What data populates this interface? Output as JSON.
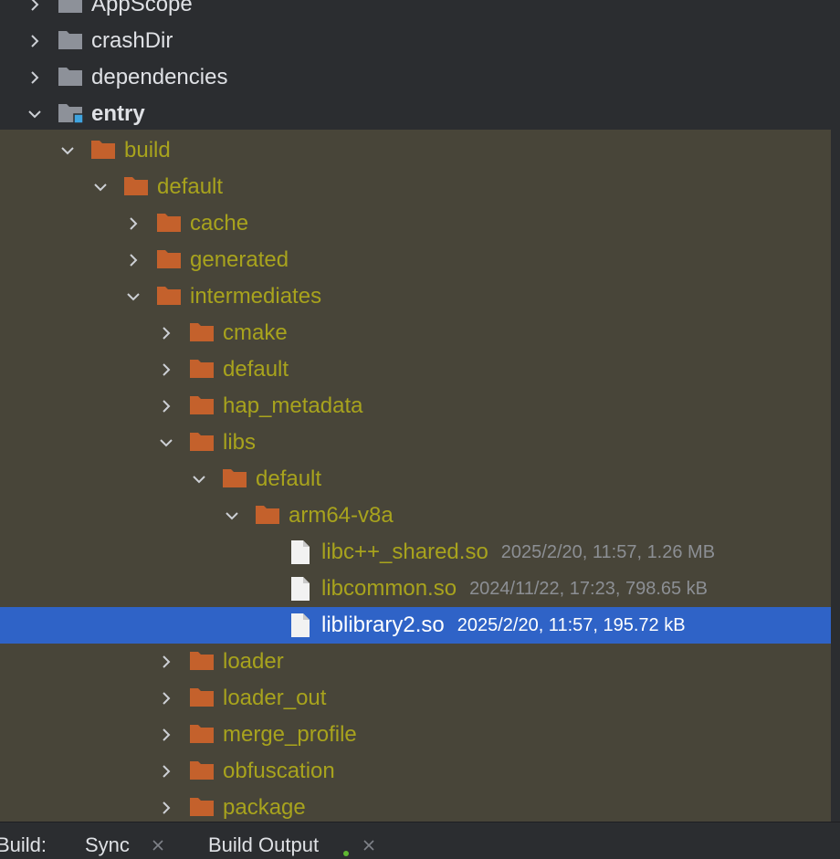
{
  "tree": {
    "rows": [
      {
        "label": "AppScope",
        "depth": 0,
        "chevron": "right",
        "icon": "folder-gray",
        "style": "normal",
        "meta": ""
      },
      {
        "label": "crashDir",
        "depth": 0,
        "chevron": "right",
        "icon": "folder-gray",
        "style": "normal",
        "meta": ""
      },
      {
        "label": "dependencies",
        "depth": 0,
        "chevron": "right",
        "icon": "folder-gray",
        "style": "normal",
        "meta": ""
      },
      {
        "label": "entry",
        "depth": 0,
        "chevron": "down",
        "icon": "folder-module",
        "style": "bold",
        "meta": ""
      },
      {
        "label": "build",
        "depth": 1,
        "chevron": "down",
        "icon": "folder-orange",
        "style": "olive",
        "meta": ""
      },
      {
        "label": "default",
        "depth": 2,
        "chevron": "down",
        "icon": "folder-orange",
        "style": "olive",
        "meta": ""
      },
      {
        "label": "cache",
        "depth": 3,
        "chevron": "right",
        "icon": "folder-orange",
        "style": "olive",
        "meta": ""
      },
      {
        "label": "generated",
        "depth": 3,
        "chevron": "right",
        "icon": "folder-orange",
        "style": "olive",
        "meta": ""
      },
      {
        "label": "intermediates",
        "depth": 3,
        "chevron": "down",
        "icon": "folder-orange",
        "style": "olive",
        "meta": ""
      },
      {
        "label": "cmake",
        "depth": 4,
        "chevron": "right",
        "icon": "folder-orange",
        "style": "olive",
        "meta": ""
      },
      {
        "label": "default",
        "depth": 4,
        "chevron": "right",
        "icon": "folder-orange",
        "style": "olive",
        "meta": ""
      },
      {
        "label": "hap_metadata",
        "depth": 4,
        "chevron": "right",
        "icon": "folder-orange",
        "style": "olive",
        "meta": ""
      },
      {
        "label": "libs",
        "depth": 4,
        "chevron": "down",
        "icon": "folder-orange",
        "style": "olive",
        "meta": ""
      },
      {
        "label": "default",
        "depth": 5,
        "chevron": "down",
        "icon": "folder-orange",
        "style": "olive",
        "meta": ""
      },
      {
        "label": "arm64-v8a",
        "depth": 6,
        "chevron": "down",
        "icon": "folder-orange",
        "style": "olive",
        "meta": ""
      },
      {
        "label": "libc++_shared.so",
        "depth": 7,
        "chevron": "none",
        "icon": "file-icon",
        "style": "olive",
        "meta": "2025/2/20, 11:57, 1.26 MB"
      },
      {
        "label": "libcommon.so",
        "depth": 7,
        "chevron": "none",
        "icon": "file-icon",
        "style": "olive",
        "meta": "2024/11/22, 17:23, 798.65 kB"
      },
      {
        "label": "liblibrary2.so",
        "depth": 7,
        "chevron": "none",
        "icon": "file-icon",
        "style": "selected",
        "meta": "2025/2/20, 11:57, 195.72 kB"
      },
      {
        "label": "loader",
        "depth": 4,
        "chevron": "right",
        "icon": "folder-orange",
        "style": "olive",
        "meta": ""
      },
      {
        "label": "loader_out",
        "depth": 4,
        "chevron": "right",
        "icon": "folder-orange",
        "style": "olive",
        "meta": ""
      },
      {
        "label": "merge_profile",
        "depth": 4,
        "chevron": "right",
        "icon": "folder-orange",
        "style": "olive",
        "meta": ""
      },
      {
        "label": "obfuscation",
        "depth": 4,
        "chevron": "right",
        "icon": "folder-orange",
        "style": "olive",
        "meta": ""
      },
      {
        "label": "package",
        "depth": 4,
        "chevron": "right",
        "icon": "folder-orange",
        "style": "olive",
        "meta": ""
      }
    ]
  },
  "bottom_bar": {
    "prefix": "Build:",
    "tabs": [
      {
        "label": "Sync",
        "closable": true
      },
      {
        "label": "Build Output",
        "closable": true
      }
    ]
  },
  "colors": {
    "background": "#2b2d30",
    "excluded_background": "#484539",
    "selection": "#2f63c7",
    "olive_text": "#a8a31d",
    "folder_orange": "#c4612c",
    "folder_gray": "#8d9199",
    "module_badge": "#3fa4e0"
  }
}
